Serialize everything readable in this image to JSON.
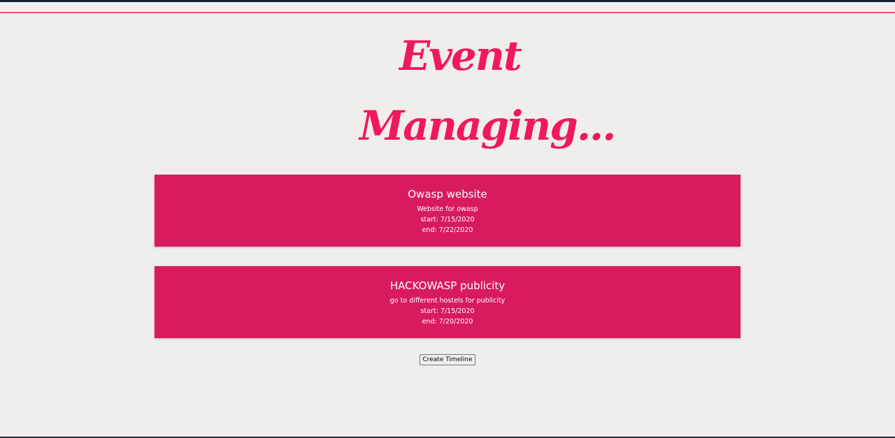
{
  "header": {
    "title_line_1": "Event",
    "title_line_2": "Managing..."
  },
  "events": [
    {
      "title": "Owasp website",
      "description": "Website for owasp",
      "start": "start: 7/15/2020",
      "end": "end: 7/22/2020"
    },
    {
      "title": "HACKOWASP publicity",
      "description": "go to different hostels for publicity",
      "start": "start: 7/15/2020",
      "end": "end: 7/20/2020"
    }
  ],
  "actions": {
    "create_timeline_label": "Create Timeline"
  },
  "colors": {
    "accent": "#f0195b",
    "card_background": "#d81b5e",
    "page_background": "#f0eeec"
  }
}
